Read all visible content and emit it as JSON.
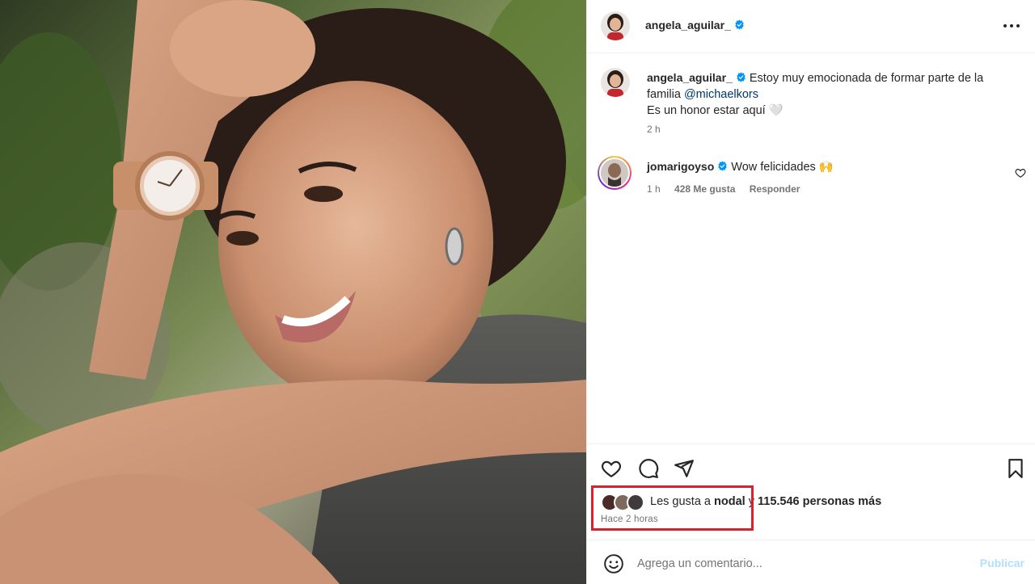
{
  "post": {
    "author": "angela_aguilar_",
    "caption_line1": "Estoy muy emocionada de formar parte de la",
    "caption_line2_prefix": "familia ",
    "caption_mention": "@michaelkors",
    "caption_line3": "Es un honor estar aquí 🤍",
    "caption_time": "2 h"
  },
  "comment": {
    "author": "jomarigoyso",
    "text": "Wow felicidades 🙌",
    "time": "1 h",
    "likes": "428 Me gusta",
    "reply_label": "Responder"
  },
  "likes": {
    "prefix": "Les gusta a ",
    "user": "nodal",
    "middle": " y ",
    "count": "115.546 personas más",
    "when": "Hace 2 horas"
  },
  "composer": {
    "placeholder": "Agrega un comentario...",
    "post_label": "Publicar"
  },
  "icons": {
    "verified": "verified-badge-icon",
    "more": "more-options-icon",
    "like": "heart-icon",
    "comment": "comment-icon",
    "share": "share-icon",
    "save": "bookmark-icon",
    "emoji": "emoji-icon"
  },
  "colors": {
    "verified": "#0095f6",
    "mention": "#00376b",
    "highlight": "#d6232f",
    "post_button": "#b2dffc"
  }
}
